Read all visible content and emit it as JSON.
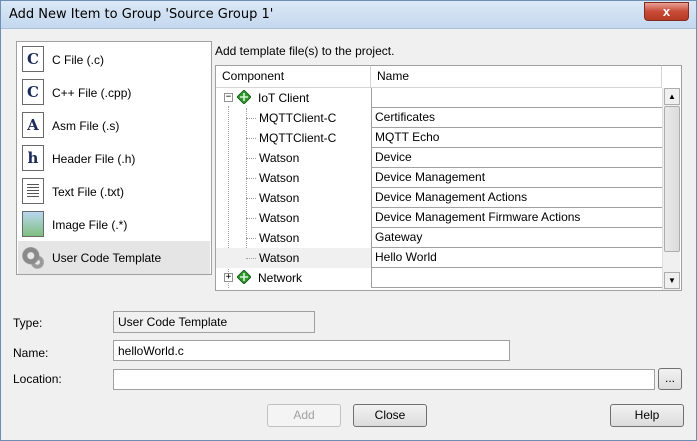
{
  "window": {
    "title": "Add New Item to Group 'Source Group 1'",
    "close_glyph": "x"
  },
  "file_types": [
    {
      "label": "C File (.c)",
      "icon": "c-file-icon",
      "glyph": "C"
    },
    {
      "label": "C++ File (.cpp)",
      "icon": "cpp-file-icon",
      "glyph": "C"
    },
    {
      "label": "Asm File (.s)",
      "icon": "asm-file-icon",
      "glyph": "A"
    },
    {
      "label": "Header File (.h)",
      "icon": "header-file-icon",
      "glyph": "h"
    },
    {
      "label": "Text File (.txt)",
      "icon": "text-file-icon",
      "glyph": ""
    },
    {
      "label": "Image File (.*)",
      "icon": "image-file-icon",
      "glyph": ""
    },
    {
      "label": "User Code Template",
      "icon": "gear-icon",
      "glyph": "",
      "selected": true
    }
  ],
  "template_panel": {
    "hint": "Add template file(s) to the project.",
    "columns": [
      "Component",
      "Name"
    ],
    "rows": [
      {
        "component": "IoT Client",
        "name": "",
        "level": 0,
        "expander": "−",
        "icon": true
      },
      {
        "component": "MQTTClient-C",
        "name": "Certificates",
        "level": 1
      },
      {
        "component": "MQTTClient-C",
        "name": "MQTT Echo",
        "level": 1
      },
      {
        "component": "Watson",
        "name": "Device",
        "level": 1
      },
      {
        "component": "Watson",
        "name": "Device Management",
        "level": 1
      },
      {
        "component": "Watson",
        "name": "Device Management Actions",
        "level": 1
      },
      {
        "component": "Watson",
        "name": "Device Management Firmware Actions",
        "level": 1
      },
      {
        "component": "Watson",
        "name": "Gateway",
        "level": 1
      },
      {
        "component": "Watson",
        "name": "Hello World",
        "level": 1,
        "highlight": true
      },
      {
        "component": "Network",
        "name": "",
        "level": 0,
        "expander": "+",
        "icon": true
      }
    ],
    "scroll_up": "▲",
    "scroll_down": "▼"
  },
  "form": {
    "type_label": "Type:",
    "type_value": "User Code Template",
    "name_label": "Name:",
    "name_value": "helloWorld.c",
    "location_label": "Location:",
    "location_value": "",
    "browse_label": "..."
  },
  "buttons": {
    "add": "Add",
    "close": "Close",
    "help": "Help"
  },
  "colors": {
    "component_icon": "#2e9a2e",
    "selection": "#e5e5e5"
  }
}
